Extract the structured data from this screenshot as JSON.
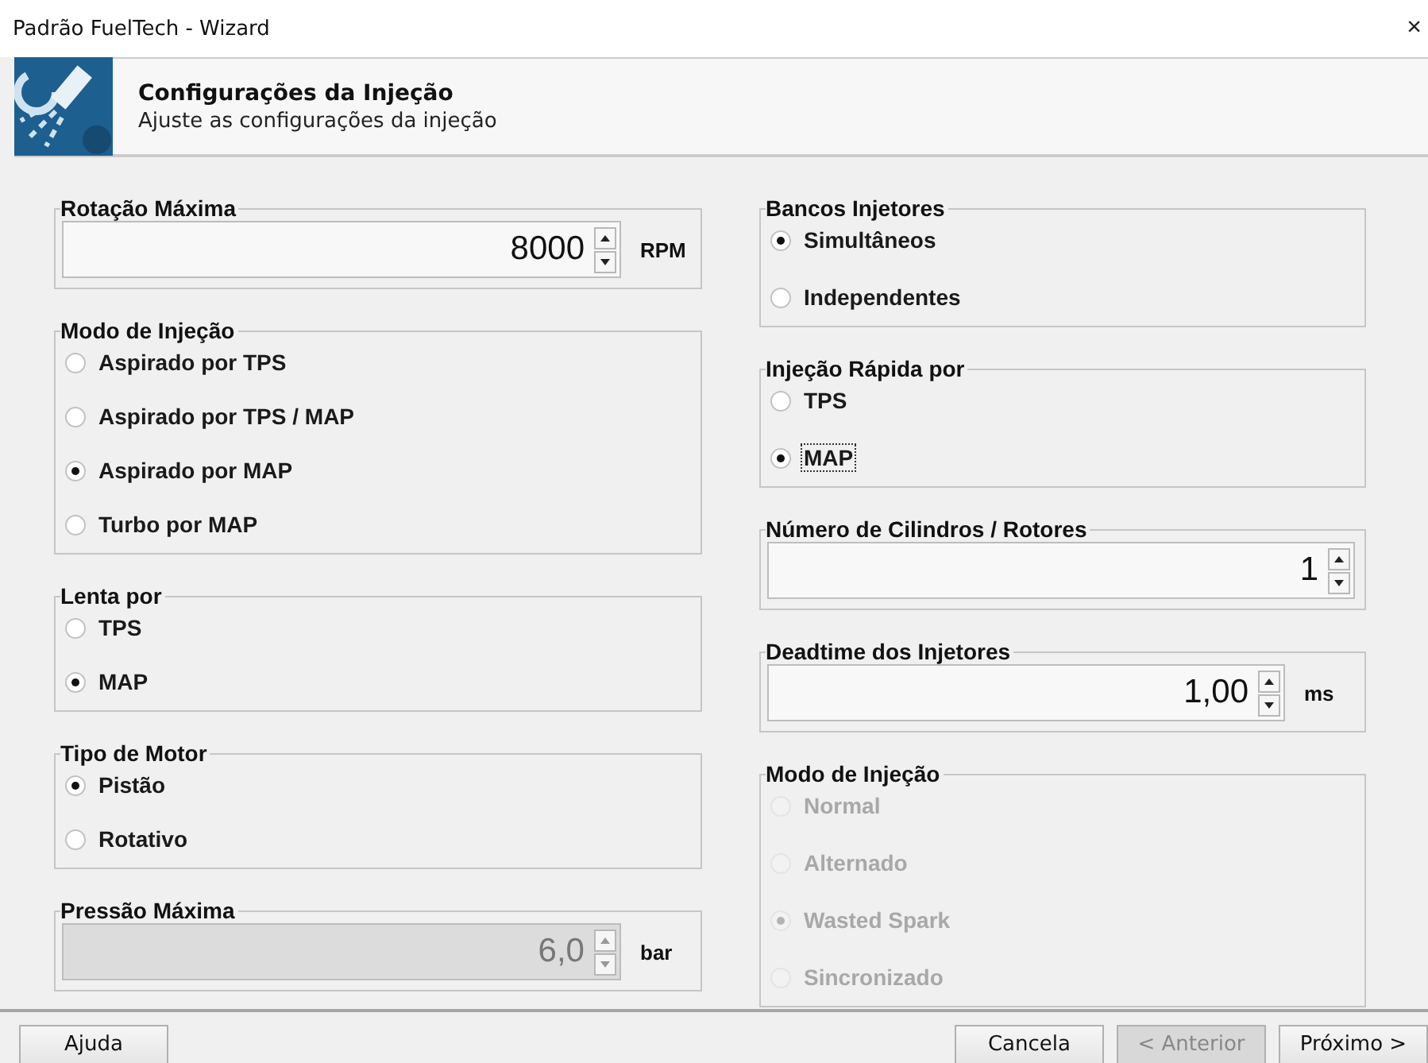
{
  "window": {
    "title": "Padrão FuelTech - Wizard",
    "close": "×"
  },
  "header": {
    "title": "Configurações da Injeção",
    "subtitle": "Ajuste as configurações da injeção"
  },
  "columns": [
    {
      "groups": [
        {
          "kind": "spin",
          "title": "Rotação Máxima",
          "value": "8000",
          "unit": "RPM",
          "disabled": false
        },
        {
          "kind": "radio",
          "title": "Modo de Injeção",
          "disabled": false,
          "options": [
            {
              "label": "Aspirado por TPS",
              "selected": false,
              "focused": false
            },
            {
              "label": "Aspirado por TPS / MAP",
              "selected": false,
              "focused": false
            },
            {
              "label": "Aspirado por MAP",
              "selected": true,
              "focused": false
            },
            {
              "label": "Turbo por MAP",
              "selected": false,
              "focused": false
            }
          ]
        },
        {
          "kind": "radio",
          "title": "Lenta por",
          "disabled": false,
          "options": [
            {
              "label": "TPS",
              "selected": false,
              "focused": false
            },
            {
              "label": "MAP",
              "selected": true,
              "focused": false
            }
          ]
        },
        {
          "kind": "radio",
          "title": "Tipo de Motor",
          "disabled": false,
          "options": [
            {
              "label": "Pistão",
              "selected": true,
              "focused": false
            },
            {
              "label": "Rotativo",
              "selected": false,
              "focused": false
            }
          ]
        },
        {
          "kind": "spin",
          "title": "Pressão Máxima",
          "value": "6,0",
          "unit": "bar",
          "disabled": true
        }
      ]
    },
    {
      "groups": [
        {
          "kind": "radio",
          "title": "Bancos Injetores",
          "disabled": false,
          "options": [
            {
              "label": "Simultâneos",
              "selected": true,
              "focused": false
            },
            {
              "label": "Independentes",
              "selected": false,
              "focused": false
            }
          ]
        },
        {
          "kind": "radio",
          "title": "Injeção Rápida por",
          "disabled": false,
          "options": [
            {
              "label": "TPS",
              "selected": false,
              "focused": false
            },
            {
              "label": "MAP",
              "selected": true,
              "focused": true
            }
          ]
        },
        {
          "kind": "spin",
          "title": "Número de Cilindros / Rotores",
          "value": "1",
          "disabled": false
        },
        {
          "kind": "spin",
          "title": "Deadtime dos Injetores",
          "value": "1,00",
          "unit": "ms",
          "disabled": false
        },
        {
          "kind": "radio",
          "title": "Modo de Injeção",
          "disabled": true,
          "options": [
            {
              "label": "Normal",
              "selected": false,
              "focused": false
            },
            {
              "label": "Alternado",
              "selected": false,
              "focused": false
            },
            {
              "label": "Wasted Spark",
              "selected": true,
              "focused": false
            },
            {
              "label": "Sincronizado",
              "selected": false,
              "focused": false
            }
          ]
        }
      ]
    }
  ],
  "buttons_left": [
    {
      "label": "Ajuda",
      "disabled": false
    }
  ],
  "buttons_right": [
    {
      "label": "Cancela",
      "disabled": false
    },
    {
      "label": "< Anterior",
      "disabled": true
    },
    {
      "label": "Próximo >",
      "disabled": false
    }
  ]
}
